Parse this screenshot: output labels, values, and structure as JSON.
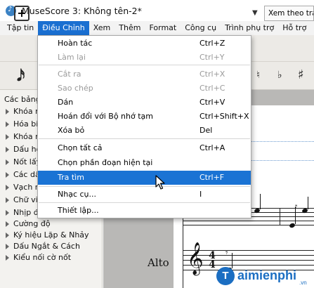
{
  "window": {
    "title": "MuseScore 3: Không tên-2*"
  },
  "menubar": [
    "Tập tin",
    "Điều Chỉnh",
    "Xem",
    "Thêm",
    "Format",
    "Công cụ",
    "Trình phụ trợ",
    "Hỗ trợ"
  ],
  "toolbar": {
    "view_mode": "Xem theo trang"
  },
  "edit_menu": {
    "items": [
      {
        "label": "Hoàn tác",
        "shortcut": "Ctrl+Z"
      },
      {
        "label": "Làm lại",
        "shortcut": "Ctrl+Y"
      },
      {
        "label": "Cắt ra",
        "shortcut": "Ctrl+X"
      },
      {
        "label": "Sao chép",
        "shortcut": "Ctrl+C"
      },
      {
        "label": "Dán",
        "shortcut": "Ctrl+V"
      },
      {
        "label": "Hoán đổi với Bộ nhớ tạm",
        "shortcut": "Ctrl+Shift+X"
      },
      {
        "label": "Xóa bỏ",
        "shortcut": "Del"
      },
      {
        "label": "Chọn tất cả",
        "shortcut": "Ctrl+A"
      },
      {
        "label": "Chọn phần đoạn hiện tại",
        "shortcut": ""
      },
      {
        "label": "Tra tìm",
        "shortcut": "Ctrl+F"
      },
      {
        "label": "Nhạc cụ...",
        "shortcut": "I"
      },
      {
        "label": "Thiết lập...",
        "shortcut": ""
      }
    ]
  },
  "palette": {
    "title": "Các bảng c",
    "items": [
      "Khóa n",
      "Hóa biể",
      "Khóa n",
      "Dấu hó",
      "Nốt lấy",
      "Các dấ",
      "Vạch n",
      "Chữ viế",
      "Nhịp đ",
      "Cường độ",
      "Ký hiệu Lặp & Nhảy",
      "Dấu Ngắt & Cách",
      "Kiểu nối cờ nốt"
    ]
  },
  "score": {
    "instrument": "Alto",
    "time_signature": {
      "top": "4",
      "bottom": "4"
    }
  },
  "watermark": {
    "brand": "aimienphi",
    "letter": "T",
    "tld": ".vn"
  },
  "colors": {
    "menu_highlight": "#1a73d4",
    "menubar_active": "#1a6fd1",
    "brand": "#1b6ec2"
  }
}
